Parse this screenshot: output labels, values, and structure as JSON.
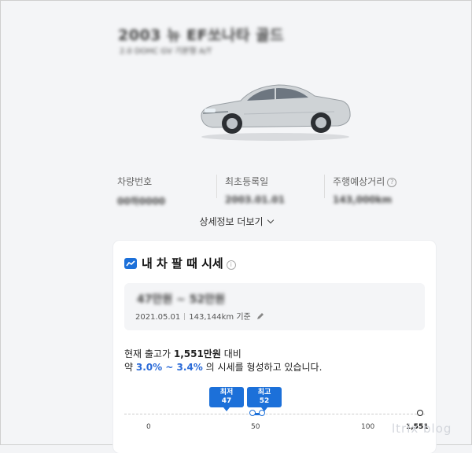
{
  "car": {
    "name": "2003 뉴 EF쏘나타 골드",
    "sub": "2.0 DOHC GV 기본형 A/T"
  },
  "info": [
    {
      "label": "차량번호",
      "value": "00하0000"
    },
    {
      "label": "최초등록일",
      "value": "2003.01.01"
    },
    {
      "label": "주행예상거리",
      "value": "143,000km"
    }
  ],
  "more_label": "상세정보 더보기",
  "card": {
    "title": "내 차 팔 때 시세",
    "price_range": "47만원 ~ 52만원",
    "date": "2021.05.01",
    "mileage": "143,144km 기준",
    "desc_line1_prefix": "현재 출고가 ",
    "desc_price": "1,551만원",
    "desc_line1_suffix": " 대비",
    "desc_line2_prefix": "약 ",
    "desc_pct": "3.0% ~ 3.4%",
    "desc_line2_suffix": " 의 시세를 형성하고 있습니다.",
    "chip_min_label": "최저",
    "chip_min_value": "47",
    "chip_max_label": "최고",
    "chip_max_value": "52",
    "ticks": [
      "0",
      "50",
      "100",
      "1,551"
    ]
  },
  "colors": {
    "accent": "#1c70d9",
    "text_blue": "#2b6bd8"
  },
  "watermark": "ltrix blog"
}
